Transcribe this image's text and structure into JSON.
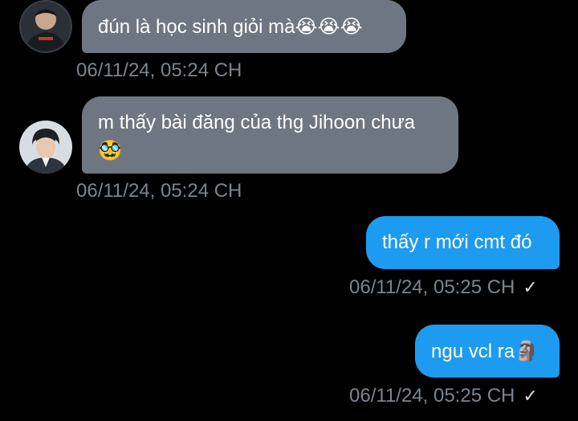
{
  "messages": [
    {
      "direction": "incoming",
      "text": "đún là học sinh giỏi mà",
      "emoji": "😭😭😭",
      "emoji_name": "loudly-crying-face",
      "timestamp": "06/11/24, 05:24 CH",
      "avatar": "contact-avatar-1"
    },
    {
      "direction": "incoming",
      "text_line1": "m thấy bài đăng của thg Jihoon chưa",
      "emoji": "🥸",
      "emoji_name": "disguised-face",
      "timestamp": "06/11/24, 05:24 CH",
      "avatar": "contact-avatar-2"
    },
    {
      "direction": "outgoing",
      "text": "thấy r mới cmt đó",
      "timestamp": "06/11/24, 05:25 CH",
      "status": "✓"
    },
    {
      "direction": "outgoing",
      "text": "ngu vcl ra",
      "emoji": "🗿",
      "emoji_name": "moai",
      "timestamp": "06/11/24, 05:25 CH",
      "status": "✓"
    }
  ],
  "colors": {
    "background": "#000000",
    "incoming_bubble": "#6e7781",
    "outgoing_bubble": "#1d9bf0",
    "timestamp": "#7b858f"
  }
}
